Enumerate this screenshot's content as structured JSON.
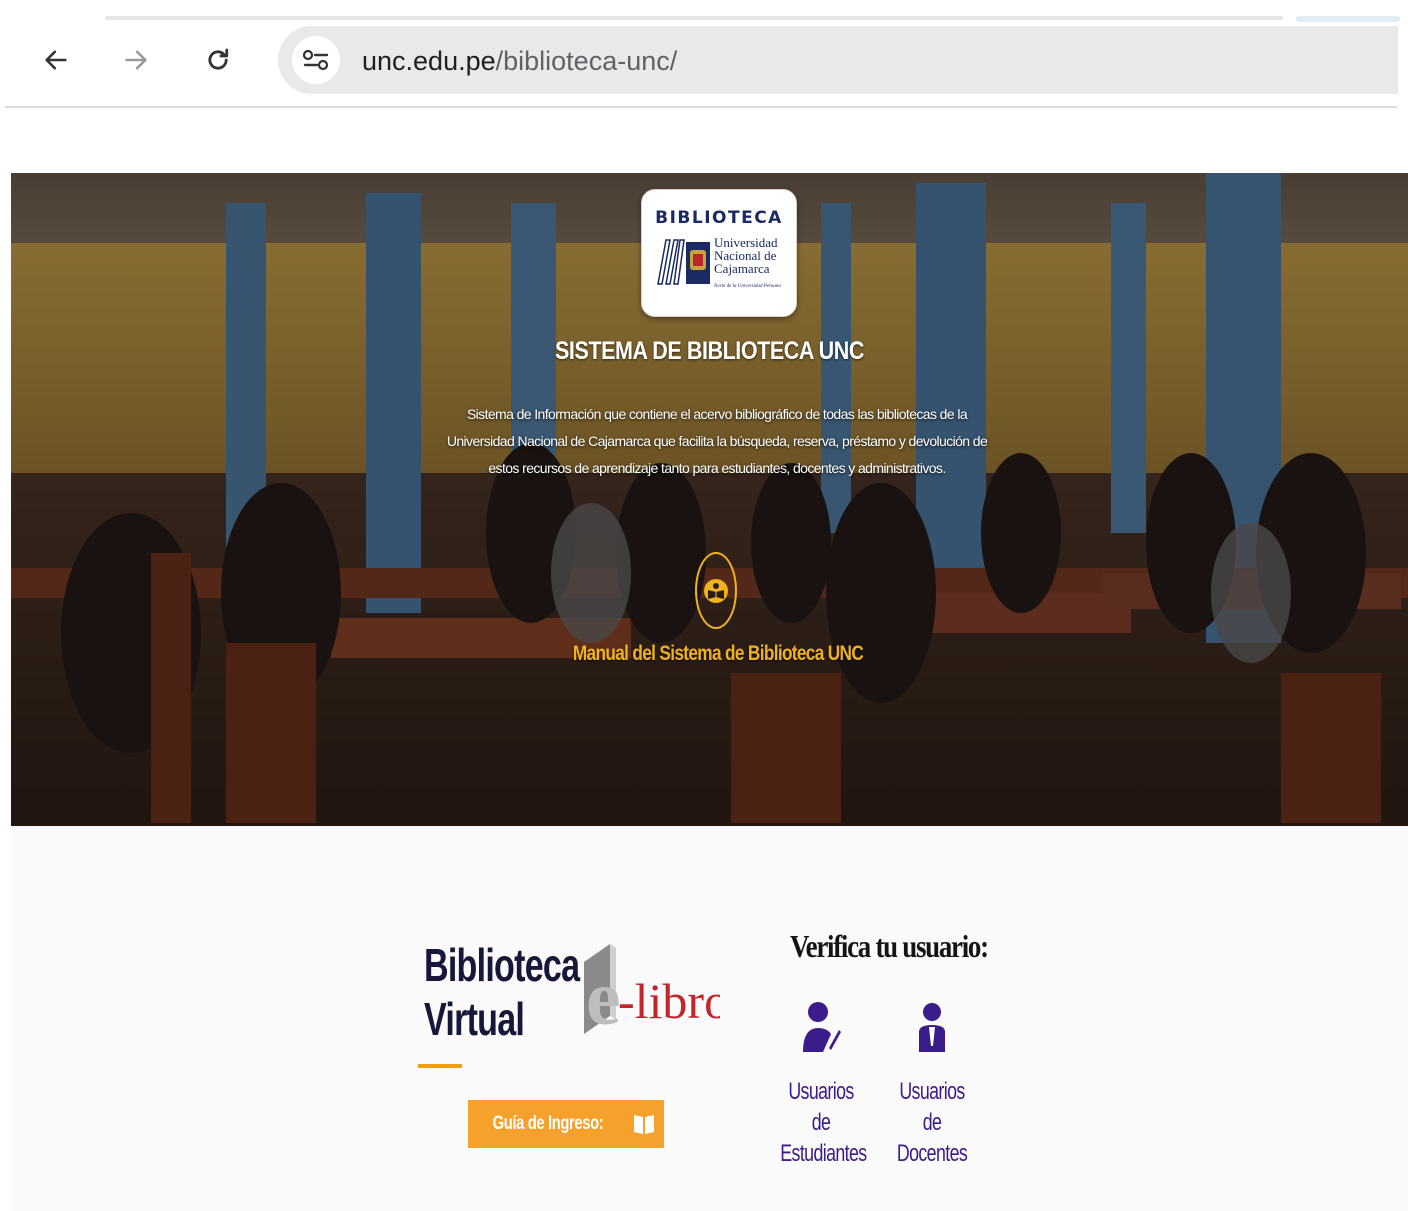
{
  "browser": {
    "url_domain": "unc.edu.pe",
    "url_path": "/biblioteca-unc/"
  },
  "hero": {
    "logo": {
      "title": "BIBLIOTECA",
      "line1": "Universidad",
      "line2": "Nacional de",
      "line3": "Cajamarca",
      "motto": "Norte de la Universidad Peruana"
    },
    "title": "SISTEMA DE BIBLIOTECA UNC",
    "description": "Sistema de Información que contiene el acervo bibliográfico de todas las bibliotecas de la Universidad Nacional de Cajamarca que facilita la búsqueda, reserva, préstamo y devolución de estos recursos de aprendizaje tanto para estudiantes, docentes y administrativos.",
    "manual_link": "Manual del Sistema de Biblioteca UNC"
  },
  "virtual": {
    "title_line1": "Biblioteca",
    "title_line2": "Virtual",
    "elibro_e": "e",
    "elibro_text": "-libro",
    "guide_button": "Guía de Ingreso:"
  },
  "verify": {
    "title": "Verifica tu usuario:",
    "students_line1": "Usuarios de",
    "students_line2": "Estudiantes",
    "teachers_line1": "Usuarios de",
    "teachers_line2": "Docentes"
  },
  "colors": {
    "accent_orange": "#f6a12c",
    "gold": "#f0b21c",
    "user_purple": "#3a1c8a",
    "navy": "#1b2a63"
  }
}
